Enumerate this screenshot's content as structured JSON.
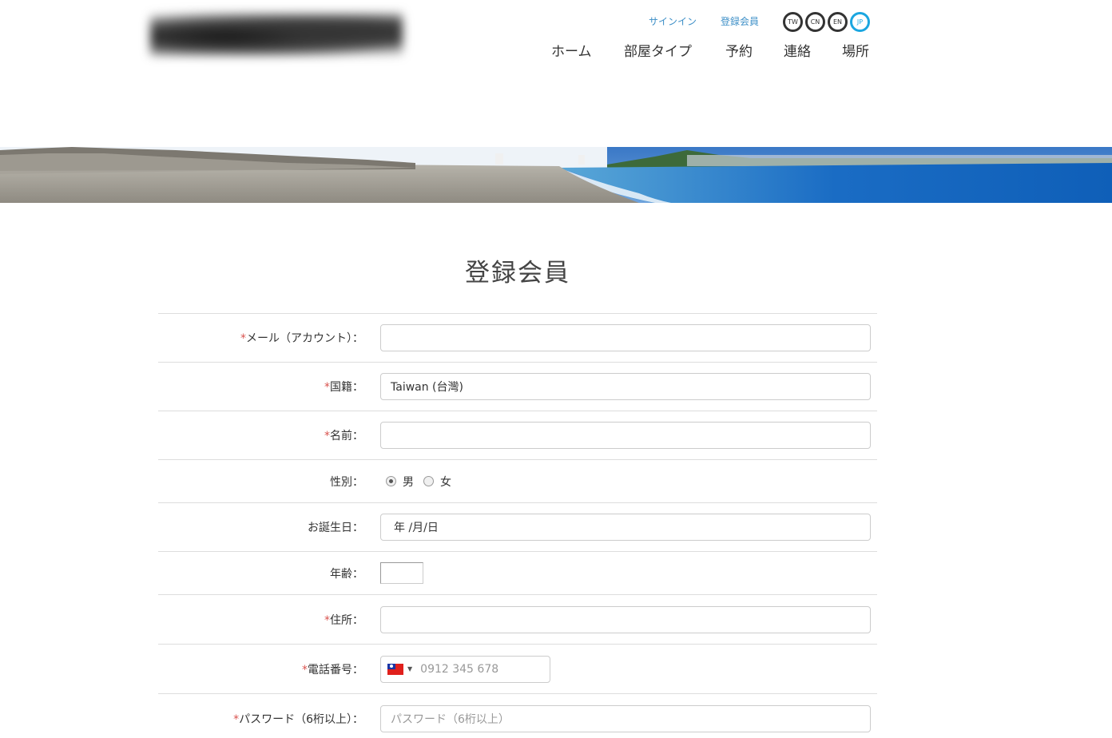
{
  "header": {
    "signin_label": "サインイン",
    "register_label": "登録会員",
    "languages": [
      {
        "code": "TW",
        "active": false
      },
      {
        "code": "CN",
        "active": false
      },
      {
        "code": "EN",
        "active": false
      },
      {
        "code": "JP",
        "active": true
      }
    ],
    "nav": [
      "ホーム",
      "部屋タイプ",
      "予約",
      "連絡",
      "場所"
    ]
  },
  "page_title": "登録会員",
  "form": {
    "email": {
      "required": "*",
      "label": "メール（アカウント）：",
      "value": ""
    },
    "nationality": {
      "required": "*",
      "label": "国籍：",
      "value": "Taiwan (台灣)"
    },
    "name": {
      "required": "*",
      "label": "名前：",
      "value": ""
    },
    "gender": {
      "label": "性別：",
      "options": [
        "男",
        "女"
      ],
      "selected": "男"
    },
    "birthday": {
      "label": "お誕生日：",
      "value": "年 /月/日"
    },
    "age": {
      "label": "年齢：",
      "value": ""
    },
    "address": {
      "required": "*",
      "label": "住所：",
      "value": ""
    },
    "phone": {
      "required": "*",
      "label": "電話番号：",
      "placeholder": "0912 345 678",
      "country": "Taiwan"
    },
    "password": {
      "required": "*",
      "label": "パスワード（6桁以上）：",
      "placeholder": "パスワード（6桁以上）"
    }
  },
  "colors": {
    "accent": "#1ba6e0",
    "link": "#3d8fc7",
    "required": "#d9534f"
  }
}
